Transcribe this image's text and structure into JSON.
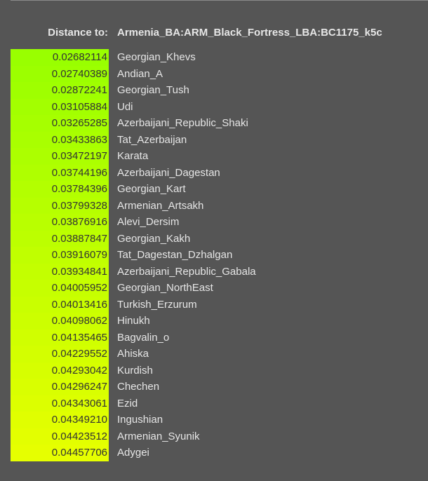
{
  "header": {
    "label": "Distance to:",
    "target": "Armenia_BA:ARM_Black_Fortress_LBA:BC1175_k5c"
  },
  "colors": {
    "background": "#555555",
    "text": "#e6e6e6",
    "distance_text": "#333333",
    "gradient_start": "#99ff00",
    "gradient_end": "#e6ff00"
  },
  "results": [
    {
      "distance": "0.02682114",
      "population": "Georgian_Khevs"
    },
    {
      "distance": "0.02740389",
      "population": "Andian_A"
    },
    {
      "distance": "0.02872241",
      "population": "Georgian_Tush"
    },
    {
      "distance": "0.03105884",
      "population": "Udi"
    },
    {
      "distance": "0.03265285",
      "population": "Azerbaijani_Republic_Shaki"
    },
    {
      "distance": "0.03433863",
      "population": "Tat_Azerbaijan"
    },
    {
      "distance": "0.03472197",
      "population": "Karata"
    },
    {
      "distance": "0.03744196",
      "population": "Azerbaijani_Dagestan"
    },
    {
      "distance": "0.03784396",
      "population": "Georgian_Kart"
    },
    {
      "distance": "0.03799328",
      "population": "Armenian_Artsakh"
    },
    {
      "distance": "0.03876916",
      "population": "Alevi_Dersim"
    },
    {
      "distance": "0.03887847",
      "population": "Georgian_Kakh"
    },
    {
      "distance": "0.03916079",
      "population": "Tat_Dagestan_Dzhalgan"
    },
    {
      "distance": "0.03934841",
      "population": "Azerbaijani_Republic_Gabala"
    },
    {
      "distance": "0.04005952",
      "population": "Georgian_NorthEast"
    },
    {
      "distance": "0.04013416",
      "population": "Turkish_Erzurum"
    },
    {
      "distance": "0.04098062",
      "population": "Hinukh"
    },
    {
      "distance": "0.04135465",
      "population": "Bagvalin_o"
    },
    {
      "distance": "0.04229552",
      "population": "Ahiska"
    },
    {
      "distance": "0.04293042",
      "population": "Kurdish"
    },
    {
      "distance": "0.04296247",
      "population": "Chechen"
    },
    {
      "distance": "0.04343061",
      "population": "Ezid"
    },
    {
      "distance": "0.04349210",
      "population": "Ingushian"
    },
    {
      "distance": "0.04423512",
      "population": "Armenian_Syunik"
    },
    {
      "distance": "0.04457706",
      "population": "Adygei"
    }
  ]
}
